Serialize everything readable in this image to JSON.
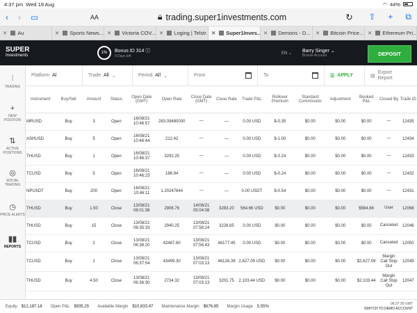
{
  "status": {
    "time": "4:37 pm",
    "date": "Wed 18 Aug",
    "battery": "44%"
  },
  "browser": {
    "aa": "AA",
    "url": "trading.super1investments.com"
  },
  "tabs": [
    {
      "label": "Au"
    },
    {
      "label": "Sports News..."
    },
    {
      "label": "Victoria COV..."
    },
    {
      "label": "Loging | Telstr..."
    },
    {
      "label": "Super1Inves..."
    },
    {
      "label": "Demons - D..."
    },
    {
      "label": "Bitcoin Price..."
    },
    {
      "label": "Ethereum Pri..."
    }
  ],
  "header": {
    "logo_top": "SUPER",
    "logo_bottom": "Investments",
    "bonus_pct": "1%",
    "bonus": "Bonus ID 314",
    "bonus_sub": "9 Days left",
    "lang": "EN",
    "user": "Barry Singer",
    "user_sub": "Bronze Account",
    "deposit": "DEPOSIT"
  },
  "sidebar": [
    {
      "label": "TRADING"
    },
    {
      "label": "NEW POSITION"
    },
    {
      "label": "ACTIVE POSITIONS"
    },
    {
      "label": "SOCIAL TRADING"
    },
    {
      "label": "PRICE ALERTS"
    },
    {
      "label": "REPORTS"
    }
  ],
  "filters": {
    "platform_label": "Platform",
    "platform": "Al",
    "trade_label": "Trade",
    "trade": "All",
    "period_label": "Period",
    "period": "All",
    "from": "From",
    "to": "To",
    "apply": "APPLY",
    "export": "Export Report"
  },
  "columns": [
    "Instrument",
    "Buy/Sell",
    "Amount",
    "Status",
    "Open Date (GMT)",
    "Open Rate",
    "Close Date (GMT)",
    "Close Rate",
    "Trade P&L",
    "Rollover Premium",
    "Standard Commission",
    "Adjustment",
    "Booked P&L",
    "Closed By",
    "Trade ID"
  ],
  "rows": [
    [
      "MRUSD",
      "Buy",
      "3",
      "Open",
      "16/08/21 10:46:57",
      "283.09480000",
      "—",
      "—",
      "0.00 USD",
      "$-0.35",
      "$0.00",
      "$0.00",
      "$0.00",
      "—",
      "12435"
    ],
    [
      "ASHUSD",
      "Buy",
      "5",
      "Open",
      "16/08/21 10:46:44",
      "212.42",
      "—",
      "—",
      "0.00 USD",
      "$-1.00",
      "$0.00",
      "$0.00",
      "$0.00",
      "—",
      "12434"
    ],
    [
      "THUSD",
      "Buy",
      "1",
      "Open",
      "16/08/21 10:46:37",
      "3292.25",
      "—",
      "—",
      "0.00 USD",
      "$-0.24",
      "$0.00",
      "$0.00",
      "$0.00",
      "—",
      "12433"
    ],
    [
      "TCUSD",
      "Buy",
      "5",
      "Open",
      "16/08/21 10:46:23",
      "186.94",
      "—",
      "—",
      "0.00 USD",
      "$-0.24",
      "$0.00",
      "$0.00",
      "$0.00",
      "—",
      "12432"
    ],
    [
      "NPUSDT",
      "Buy",
      "200",
      "Open",
      "16/08/21 10:46:11",
      "1.20247644",
      "—",
      "—",
      "0.00 USDT",
      "$-0.54",
      "$0.00",
      "$0.00",
      "$0.00",
      "—",
      "12431"
    ],
    [
      "THUSD",
      "Buy",
      "1.50",
      "Close",
      "13/08/21 08:01:38",
      "2906.76",
      "14/08/21 05:04:08",
      "3283.20",
      "564.66 USD",
      "$0.00",
      "$0.00",
      "$0.00",
      "$564.66",
      "User",
      "12068"
    ],
    [
      "THUSD",
      "Buy",
      "15",
      "Close",
      "13/08/21 06:35:33",
      "2940.25",
      "13/08/21 07:58:24",
      "3228.65",
      "0.00 USD",
      "$0.00",
      "$0.00",
      "$0.00",
      "$0.00",
      "Canceled",
      "12046"
    ],
    [
      "TCUSD",
      "Buy",
      "2",
      "Close",
      "13/08/21 06:38:20",
      "42487.60",
      "13/08/21 07:56:43",
      "46177.45",
      "0.00 USD",
      "$0.00",
      "$0.00",
      "$0.00",
      "$0.00",
      "Canceled",
      "12050"
    ],
    [
      "TCUSD",
      "Buy",
      "1",
      "Close",
      "13/08/21 06:37:54",
      "43499.30",
      "13/08/21 07:03:13",
      "46126.39",
      "2,627.09 USD",
      "$0.00",
      "$0.00",
      "$0.00",
      "$2,627.09",
      "Margin Call Stop Out",
      "12049"
    ],
    [
      "THUSD",
      "Buy",
      "4.50",
      "Close",
      "13/08/21 06:36:30",
      "2734.32",
      "13/08/21 07:03:13",
      "3201.75",
      "2,103.44 USD",
      "$0.00",
      "$0.00",
      "$0.00",
      "$2,103.44",
      "Margin Call Stop Out",
      "12047"
    ]
  ],
  "footer": {
    "equity_label": "Equity",
    "equity": "$12,187.18",
    "pnl_label": "Open P&L",
    "pnl": "$935.25",
    "avail_label": "Available Margin",
    "avail": "$10,833.47",
    "maint_label": "Maintenance Margin",
    "maint": "$676.85",
    "usage_label": "Margin Usage",
    "usage": "5.55%",
    "time": "06:37:30 GMT",
    "switch": "SWITCH TO DEMO ACCOUNT"
  }
}
